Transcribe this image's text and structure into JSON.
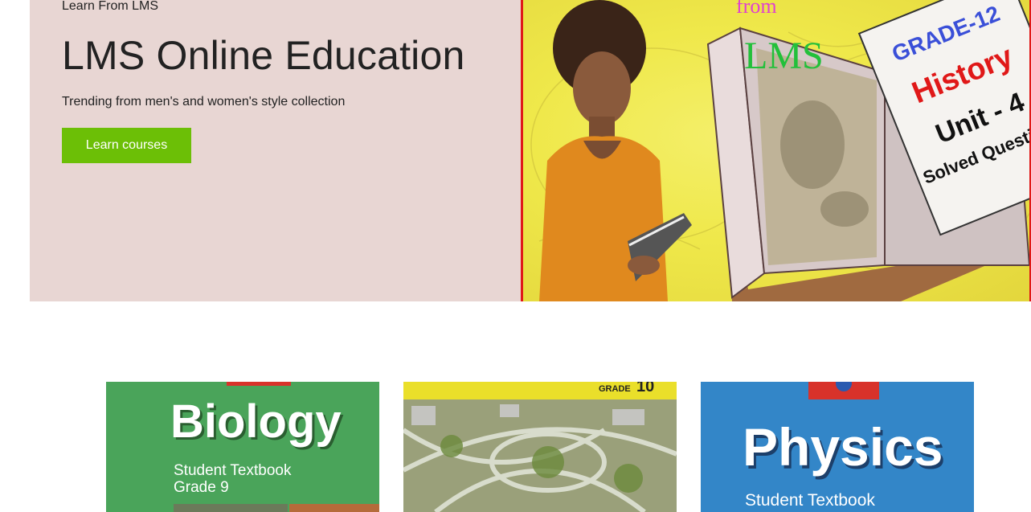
{
  "hero": {
    "kicker": "Learn From LMS",
    "title": "LMS Online Education",
    "subtitle": "Trending from men's and women's style collection",
    "cta_label": "Learn courses",
    "cta_color": "#6cbf06",
    "background": "#e8d6d3"
  },
  "hero_image": {
    "top_text": "from",
    "logo_text": "LMS",
    "grade": "GRADE-12",
    "subject": "History",
    "unit": "Unit - 4",
    "caption": "Solved Questions"
  },
  "cards": [
    {
      "title": "Biology",
      "line1": "Student Textbook",
      "line2": "Grade 9",
      "color": "#4aa45a"
    },
    {
      "grade_label": "GRADE",
      "grade_number": "10",
      "color": "#eadf2a"
    },
    {
      "title": "Physics",
      "line1": "Student Textbook",
      "color": "#3386c8"
    }
  ]
}
